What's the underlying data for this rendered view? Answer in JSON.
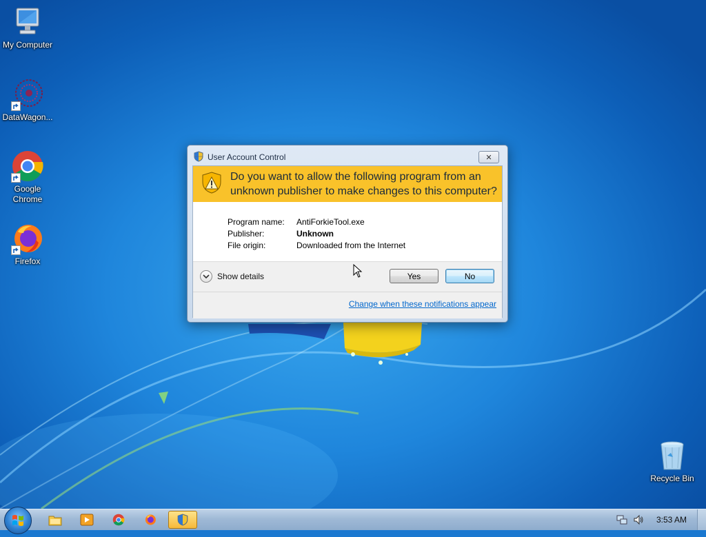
{
  "desktop": {
    "icons": [
      {
        "label": "My Computer",
        "icon": "computer-icon"
      },
      {
        "label": "DataWagon...",
        "icon": "datawagon-icon"
      },
      {
        "label": "Google\nChrome",
        "line1": "Google",
        "line2": "Chrome",
        "icon": "chrome-icon"
      },
      {
        "label": "Firefox",
        "icon": "firefox-icon"
      },
      {
        "label": "Recycle Bin",
        "icon": "recycle-bin-icon"
      }
    ]
  },
  "uac": {
    "title": "User Account Control",
    "close_label": "✕",
    "question_line1": "Do you want to allow the following program from an",
    "question_line2": "unknown publisher to make changes to this computer?",
    "fields": [
      {
        "key": "Program name:",
        "value": "AntiForkieTool.exe"
      },
      {
        "key": "Publisher:",
        "value": "Unknown"
      },
      {
        "key": "File origin:",
        "value": "Downloaded from the Internet"
      }
    ],
    "show_details": "Show details",
    "yes_label": "Yes",
    "no_label": "No",
    "link": "Change when these notifications appear",
    "banner_color": "#f9c22a"
  },
  "taskbar": {
    "pinned": [
      "explorer-icon",
      "media-player-icon",
      "chrome-icon",
      "firefox-icon",
      "uac-shield-icon"
    ],
    "clock": "3:53 AM"
  }
}
